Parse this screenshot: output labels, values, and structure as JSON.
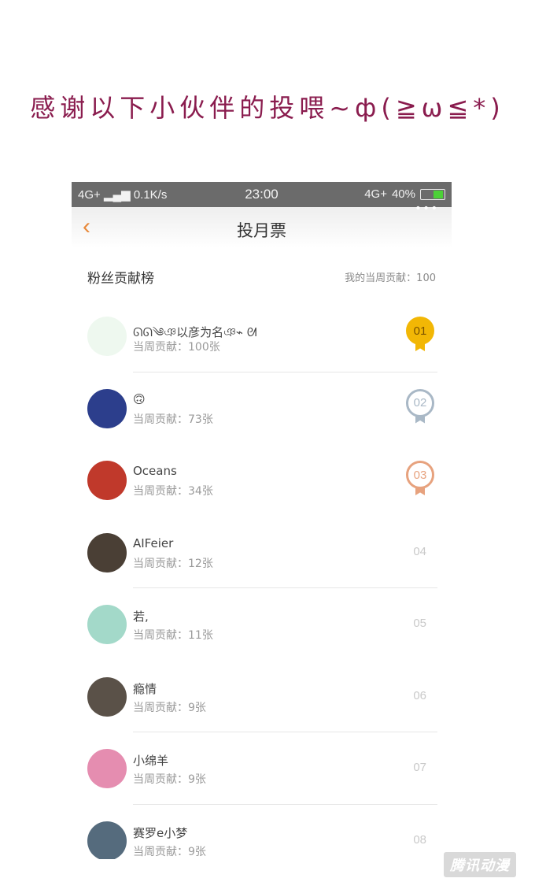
{
  "caption": "感谢以下小伙伴的投喂~ф(≧ω≦*)",
  "status_bar": {
    "network_left": "4G+",
    "speed": "0.1K/s",
    "time": "23:00",
    "network_right": "4G+",
    "battery": "40%"
  },
  "nav": {
    "back_icon": "chevron-left-icon",
    "title": "投月票",
    "more": "•••"
  },
  "section": {
    "title": "粉丝贡献榜",
    "my_contribution": "我的当周贡献：100"
  },
  "fans": [
    {
      "name": "ᘏᘏ༄ঞ以彦为名ঞ⌁ ᘛ",
      "contribution": "当周贡献：100张",
      "rank": "01",
      "avatar_color": "#eef8ef"
    },
    {
      "name": "🙃",
      "contribution": "当周贡献：73张",
      "rank": "02",
      "avatar_color": "#2c3e8c"
    },
    {
      "name": "Oceans",
      "contribution": "当周贡献：34张",
      "rank": "03",
      "avatar_color": "#c0392b"
    },
    {
      "name": "AIFeier",
      "contribution": "当周贡献：12张",
      "rank": "04",
      "avatar_color": "#4a3f35"
    },
    {
      "name": "若,",
      "contribution": "当周贡献：11张",
      "rank": "05",
      "avatar_color": "#a3d9c9"
    },
    {
      "name": "瘾情",
      "contribution": "当周贡献：9张",
      "rank": "06",
      "avatar_color": "#5a5148"
    },
    {
      "name": "小绵羊",
      "contribution": "当周贡献：9张",
      "rank": "07",
      "avatar_color": "#e58db0"
    },
    {
      "name": "赛罗e小梦",
      "contribution": "当周贡献：9张",
      "rank": "08",
      "avatar_color": "#556b7d"
    }
  ],
  "medal_colors": {
    "gold": "#f2b705",
    "silver": "#a9b8c6",
    "bronze": "#e7a27e"
  },
  "watermark": "腾讯动漫"
}
